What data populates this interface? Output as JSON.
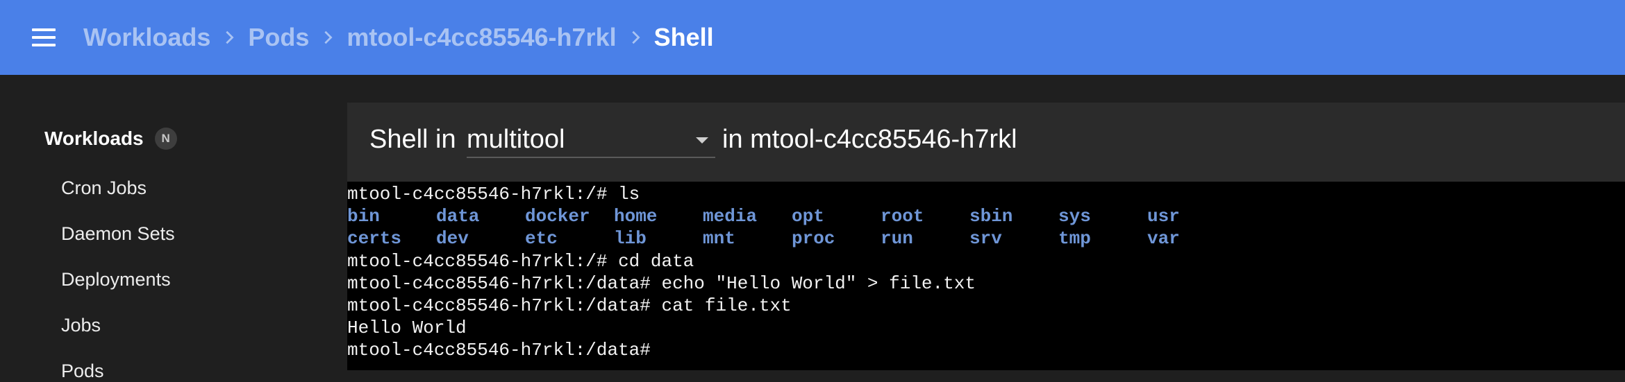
{
  "header": {
    "breadcrumbs": [
      {
        "label": "Workloads"
      },
      {
        "label": "Pods"
      },
      {
        "label": "mtool-c4cc85546-h7rkl"
      },
      {
        "label": "Shell"
      }
    ]
  },
  "sidebar": {
    "section_title": "Workloads",
    "section_badge": "N",
    "items": [
      {
        "label": "Cron Jobs"
      },
      {
        "label": "Daemon Sets"
      },
      {
        "label": "Deployments"
      },
      {
        "label": "Jobs"
      },
      {
        "label": "Pods"
      }
    ]
  },
  "shell": {
    "title_prefix": "Shell in",
    "container": "multitool",
    "title_suffix": "in mtool-c4cc85546-h7rkl"
  },
  "terminal": {
    "line1": "mtool-c4cc85546-h7rkl:/# ls",
    "ls_row1": [
      "bin",
      "data",
      "docker",
      "home",
      "media",
      "opt",
      "root",
      "sbin",
      "sys",
      "usr"
    ],
    "ls_row2": [
      "certs",
      "dev",
      "etc",
      "lib",
      "mnt",
      "proc",
      "run",
      "srv",
      "tmp",
      "var"
    ],
    "line4": "mtool-c4cc85546-h7rkl:/# cd data",
    "line5": "mtool-c4cc85546-h7rkl:/data# echo \"Hello World\" > file.txt",
    "line6": "mtool-c4cc85546-h7rkl:/data# cat file.txt",
    "line7": "Hello World",
    "line8": "mtool-c4cc85546-h7rkl:/data# "
  },
  "colors": {
    "topbar": "#4a80e8",
    "directory_listing": "#6f96d7",
    "terminal_bg": "#000000"
  }
}
